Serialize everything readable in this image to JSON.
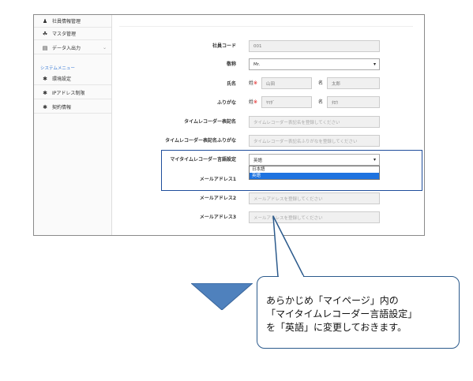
{
  "sidebar": {
    "items": [
      {
        "icon": "person-icon",
        "label": "社員情報管理"
      },
      {
        "icon": "sitemap-icon",
        "label": "マスタ管理"
      },
      {
        "icon": "import-export-icon",
        "label": "データ入出力"
      }
    ],
    "section_label": "システムメニュー",
    "system_items": [
      {
        "icon": "gear-icon",
        "label": "環境設定"
      },
      {
        "icon": "gear-icon",
        "label": "IPアドレス制限"
      },
      {
        "icon": "gear-icon",
        "label": "契約情報"
      }
    ]
  },
  "form": {
    "employee_code": {
      "label": "社員コード",
      "value": "001"
    },
    "title": {
      "label": "敬称",
      "value": "Mr."
    },
    "name": {
      "label": "氏名",
      "req_mark": "※",
      "last_prefix": "姓",
      "last_value": "山田",
      "first_prefix": "名",
      "first_value": "太郎"
    },
    "kana": {
      "label": "ふりがな",
      "req_mark": "※",
      "last_prefix": "姓",
      "last_value": "ﾔﾏﾀﾞ",
      "first_prefix": "名",
      "first_value": "ﾀﾛｳ"
    },
    "tr_name": {
      "label": "タイムレコーダー表記名",
      "placeholder": "タイムレコーダー表記名を登録してください"
    },
    "tr_kana": {
      "label": "タイムレコーダー表記名ふりがな",
      "placeholder": "タイムレコーダー表記名ふりがなを登録してください"
    },
    "tr_lang": {
      "label": "マイタイムレコーダー言語設定",
      "value": "英語",
      "options": [
        "日本語",
        "英語"
      ]
    },
    "mail1": {
      "label": "メールアドレス1"
    },
    "mail2": {
      "label": "メールアドレス2",
      "placeholder": "メールアドレスを登録してください"
    },
    "mail3": {
      "label": "メールアドレス3",
      "placeholder": "メールアドレスを登録してください"
    }
  },
  "callout": {
    "line1": "あらかじめ「マイページ」内の",
    "line2": "「マイタイムレコーダー言語設定」",
    "line3": "を「英語」に変更しておきます。"
  },
  "colors": {
    "accent": "#3a7bd5",
    "highlight_border": "#1f4e9c",
    "selected_option": "#1e73e0",
    "arrow": "#4f81bd"
  }
}
